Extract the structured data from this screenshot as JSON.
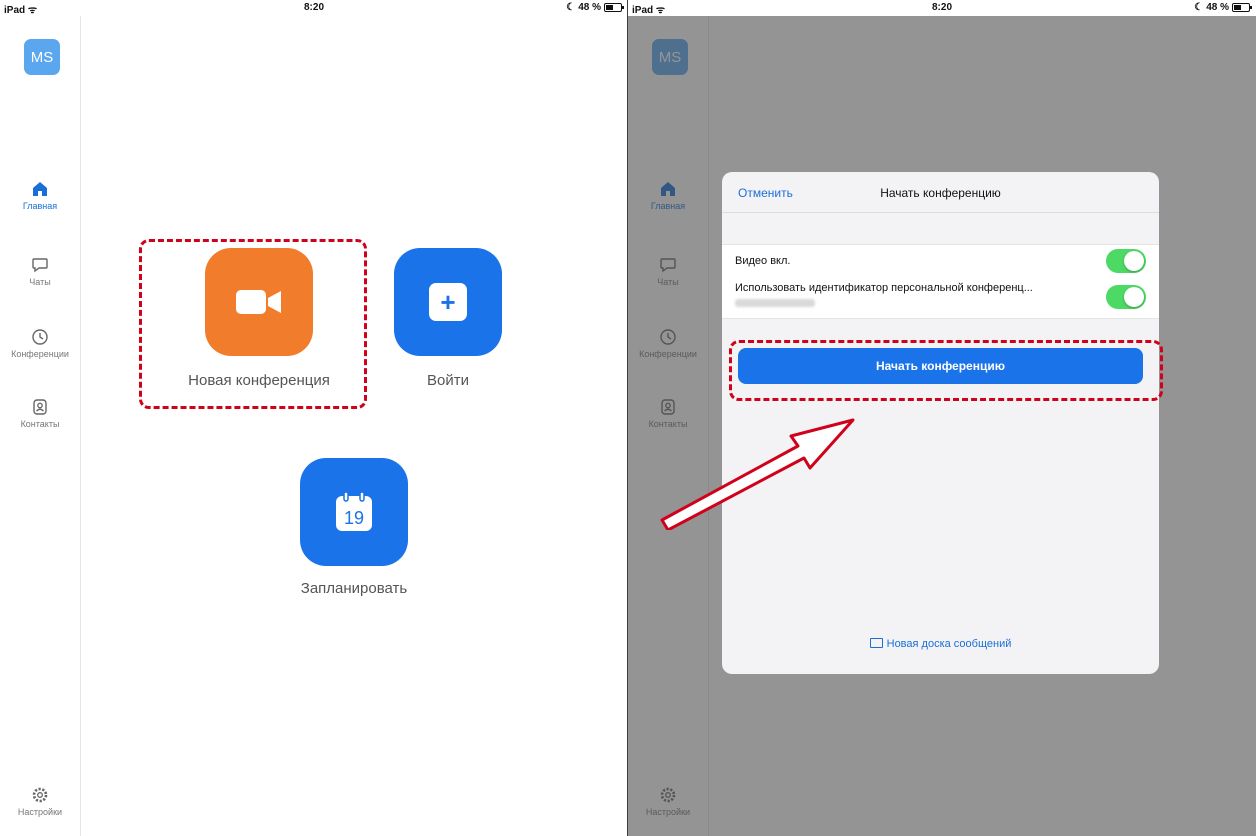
{
  "status": {
    "device": "iPad",
    "time": "8:20",
    "battery": "48 %"
  },
  "sidebar": {
    "avatar": "MS",
    "items": [
      {
        "label": "Главная",
        "icon": "home-icon"
      },
      {
        "label": "Чаты",
        "icon": "chat-icon"
      },
      {
        "label": "Конференции",
        "icon": "clock-icon"
      },
      {
        "label": "Контакты",
        "icon": "contact-icon"
      }
    ],
    "settings": "Настройки"
  },
  "home": {
    "new_meeting": "Новая конференция",
    "join": "Войти",
    "schedule": "Запланировать",
    "calendar_day": "19",
    "join_icon_text": "+"
  },
  "dialog": {
    "cancel": "Отменить",
    "title": "Начать конференцию",
    "video_on": "Видео вкл.",
    "use_pmi": "Использовать идентификатор персональной конференц...",
    "start_button": "Начать конференцию",
    "whiteboard": "Новая доска сообщений"
  },
  "colors": {
    "accent": "#1a73e8",
    "orange": "#f07c2c",
    "toggle_on": "#4cd964",
    "highlight": "#d0021b"
  }
}
